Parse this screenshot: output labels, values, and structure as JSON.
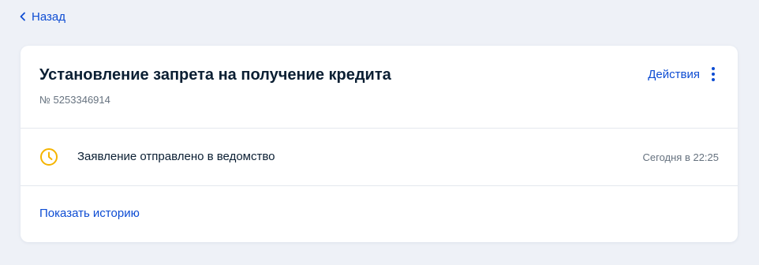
{
  "nav": {
    "back_label": "Назад",
    "back_icon": "chevron-left-icon"
  },
  "application": {
    "title": "Установление запрета на получение кредита",
    "number": "№ 5253346914",
    "actions_label": "Действия",
    "actions_icon": "kebab-menu-icon"
  },
  "status": {
    "icon": "clock-icon",
    "text": "Заявление отправлено в ведомство",
    "time": "Сегодня в 22:25"
  },
  "history": {
    "link_label": "Показать историю"
  },
  "colors": {
    "background": "#eef1f7",
    "card": "#ffffff",
    "link": "#0d4cd3",
    "text": "#0b1f33",
    "muted": "#66727f",
    "status_pending": "#f5b400"
  }
}
